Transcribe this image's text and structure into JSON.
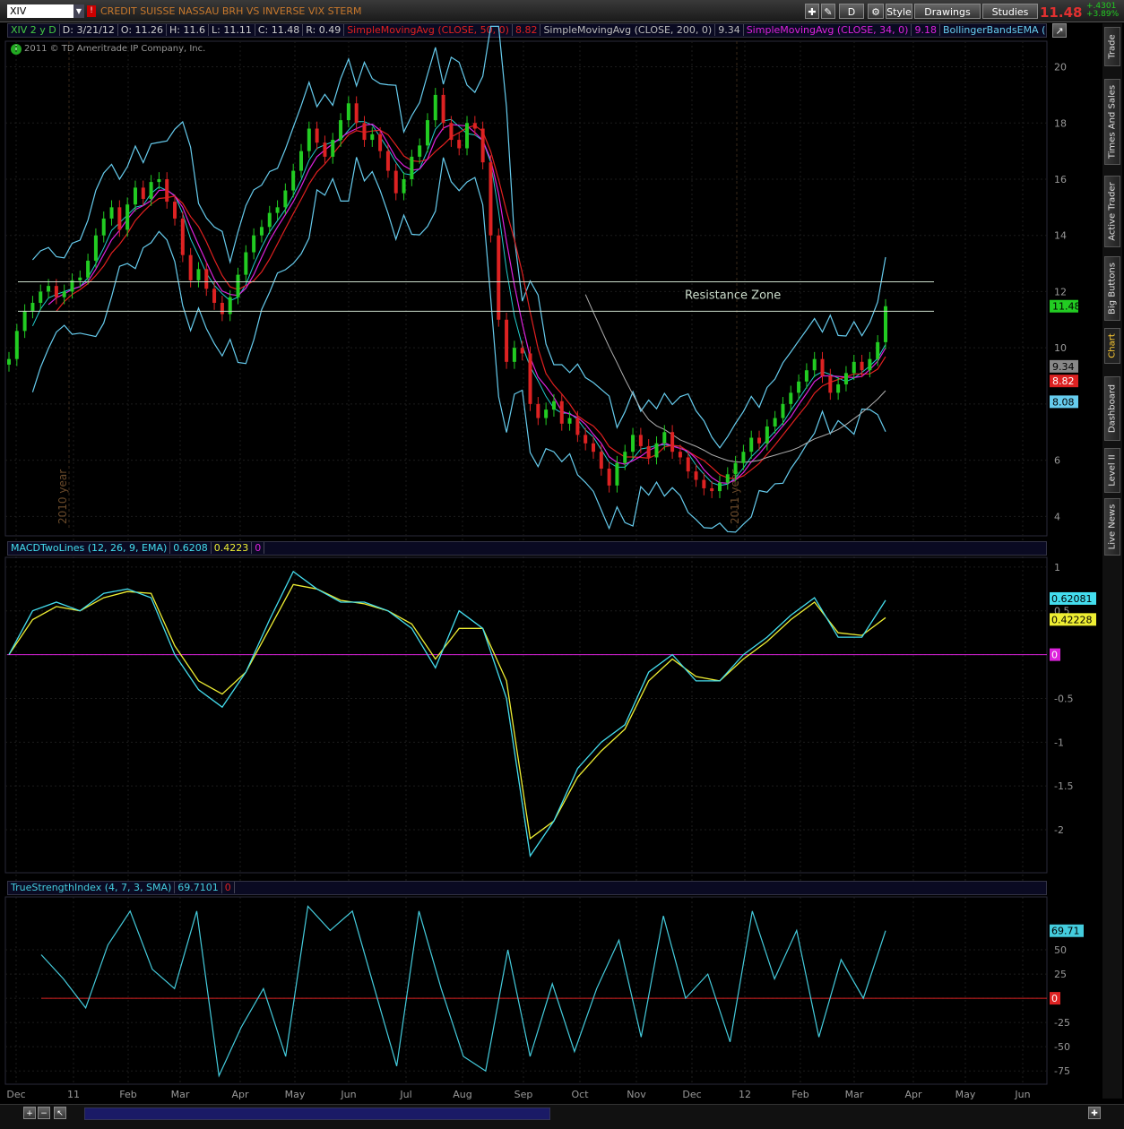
{
  "toolbar": {
    "symbol": "XIV",
    "description": "CREDIT SUISSE NASSAU BRH VS INVERSE VIX STERM",
    "last": "11.48",
    "change": "+.4301",
    "change_pct": "+3.89%",
    "style_label": "Style",
    "drawings_label": "Drawings",
    "studies_label": "Studies",
    "period_label": "D"
  },
  "infobar": {
    "period": "XIV 2 y D",
    "date": "D: 3/21/12",
    "open": "O: 11.26",
    "high": "H: 11.6",
    "low": "L: 11.11",
    "close": "C: 11.48",
    "range": "R: 0.49",
    "sma50_label": "SimpleMovingAvg (CLOSE, 50, 0)",
    "sma50_val": "8.82",
    "sma200_label": "SimpleMovingAvg (CLOSE, 200, 0)",
    "sma200_val": "9.34",
    "sma34_label": "SimpleMovingAvg (CLOSE, 34, 0)",
    "sma34_val": "9.18",
    "bb_label": "BollingerBandsEMA (..."
  },
  "copyright": "2011 © TD Ameritrade IP Company, Inc.",
  "sidetabs": [
    "Trade",
    "Times And Sales",
    "Active Trader",
    "Big Buttons",
    "Chart",
    "Dashboard",
    "Level II",
    "Live News"
  ],
  "colors": {
    "price_up": "#22cc22",
    "price_down": "#dd2222",
    "sma50": "#e02020",
    "sma200": "#b0b0b0",
    "sma34": "#dd22dd",
    "bollinger": "#66ccee",
    "macd": "#44ddee",
    "signal": "#eeee33",
    "zero": "#dd22dd",
    "tsi": "#44ccdd",
    "tsi_zero": "#dd2222"
  },
  "chart_data": [
    {
      "type": "candlestick",
      "title": "XIV 2 y D",
      "annotation": "Resistance Zone",
      "year_labels": [
        "2010 year",
        "2011 year"
      ],
      "x_ticks": [
        "Dec",
        "11",
        "Feb",
        "Mar",
        "Apr",
        "May",
        "Jun",
        "Jul",
        "Aug",
        "Sep",
        "Oct",
        "Nov",
        "Dec",
        "12",
        "Feb",
        "Mar",
        "Apr",
        "May",
        "Jun"
      ],
      "y_ticks": [
        4,
        6,
        8,
        10,
        12,
        14,
        16,
        18,
        20
      ],
      "ylim": [
        3.5,
        20.4
      ],
      "horizontal_lines": [
        12.35,
        11.3
      ],
      "close": [
        9.6,
        10.6,
        11.3,
        11.6,
        12.0,
        12.2,
        11.8,
        12.0,
        12.4,
        12.5,
        13.1,
        14.0,
        14.6,
        15.0,
        14.2,
        15.1,
        15.7,
        15.3,
        15.9,
        16.0,
        15.2,
        14.6,
        13.3,
        12.4,
        12.8,
        12.1,
        11.6,
        11.2,
        11.8,
        12.6,
        13.4,
        14.0,
        14.3,
        14.8,
        15.0,
        15.6,
        16.3,
        17.0,
        17.8,
        17.3,
        16.8,
        17.4,
        18.1,
        18.7,
        18.0,
        17.4,
        17.6,
        17.0,
        16.3,
        15.5,
        16.0,
        16.8,
        17.2,
        18.1,
        19.0,
        18.0,
        17.4,
        17.1,
        18.0,
        17.8,
        16.6,
        14.0,
        11.0,
        9.5,
        10.0,
        9.8,
        8.0,
        7.5,
        7.8,
        8.1,
        7.3,
        7.5,
        6.9,
        6.6,
        6.3,
        5.7,
        5.1,
        5.9,
        6.3,
        6.9,
        6.5,
        6.1,
        6.6,
        7.0,
        6.3,
        6.1,
        5.6,
        5.3,
        5.0,
        4.9,
        5.2,
        5.5,
        5.9,
        6.3,
        6.8,
        6.6,
        7.2,
        7.5,
        8.0,
        8.4,
        8.8,
        9.2,
        9.6,
        9.0,
        8.4,
        8.7,
        9.1,
        9.5,
        9.2,
        9.6,
        10.2,
        11.48
      ]
    },
    {
      "type": "line",
      "title": "MACDTwoLines (12, 26, 9, EMA)",
      "series": [
        {
          "name": "Value",
          "values": [
            0.0,
            0.5,
            0.6,
            0.5,
            0.7,
            0.75,
            0.65,
            0.0,
            -0.4,
            -0.6,
            -0.2,
            0.4,
            0.95,
            0.75,
            0.6,
            0.6,
            0.5,
            0.3,
            -0.15,
            0.5,
            0.3,
            -0.5,
            -2.3,
            -1.9,
            -1.3,
            -1.0,
            -0.8,
            -0.2,
            0.0,
            -0.3,
            -0.3,
            0.0,
            0.2,
            0.45,
            0.65,
            0.2,
            0.2,
            0.62081
          ]
        },
        {
          "name": "Avg",
          "values": [
            0.0,
            0.4,
            0.55,
            0.5,
            0.65,
            0.72,
            0.7,
            0.1,
            -0.3,
            -0.45,
            -0.2,
            0.3,
            0.8,
            0.75,
            0.62,
            0.58,
            0.5,
            0.35,
            -0.05,
            0.3,
            0.3,
            -0.3,
            -2.1,
            -1.9,
            -1.4,
            -1.1,
            -0.85,
            -0.3,
            -0.05,
            -0.25,
            -0.3,
            -0.05,
            0.15,
            0.4,
            0.6,
            0.25,
            0.22,
            0.42228
          ]
        }
      ],
      "y_ticks": [
        -2,
        -1.5,
        -1,
        -0.5,
        0,
        0.5,
        1
      ],
      "ylim": [
        -2.45,
        1.05
      ]
    },
    {
      "type": "line",
      "title": "TrueStrengthIndex (4, 7, 3, SMA)",
      "series": [
        {
          "name": "TSI",
          "values": [
            45,
            20,
            -10,
            55,
            90,
            30,
            10,
            90,
            -80,
            -30,
            10,
            -60,
            95,
            70,
            90,
            10,
            -70,
            90,
            10,
            -60,
            -75,
            50,
            -60,
            15,
            -55,
            10,
            60,
            -40,
            85,
            0,
            25,
            -45,
            90,
            20,
            70,
            -40,
            40,
            0,
            69.71
          ]
        }
      ],
      "y_ticks": [
        -75,
        -50,
        -25,
        0,
        25,
        50
      ],
      "ylim": [
        -85,
        100
      ]
    }
  ],
  "price_tags": {
    "last": "11.48",
    "sma200": "9.34",
    "sma50": "8.82",
    "bb_low": "8.08",
    "macd_value": "0.62081",
    "macd_avg": "0.42228",
    "macd_zero": "0",
    "tsi_value": "69.71",
    "tsi_zero": "0"
  },
  "macd_hdr": {
    "value": "0.6208",
    "avg": "0.4223",
    "diff": "0"
  },
  "tsi_hdr": {
    "value": "69.7101",
    "zero": "0"
  }
}
